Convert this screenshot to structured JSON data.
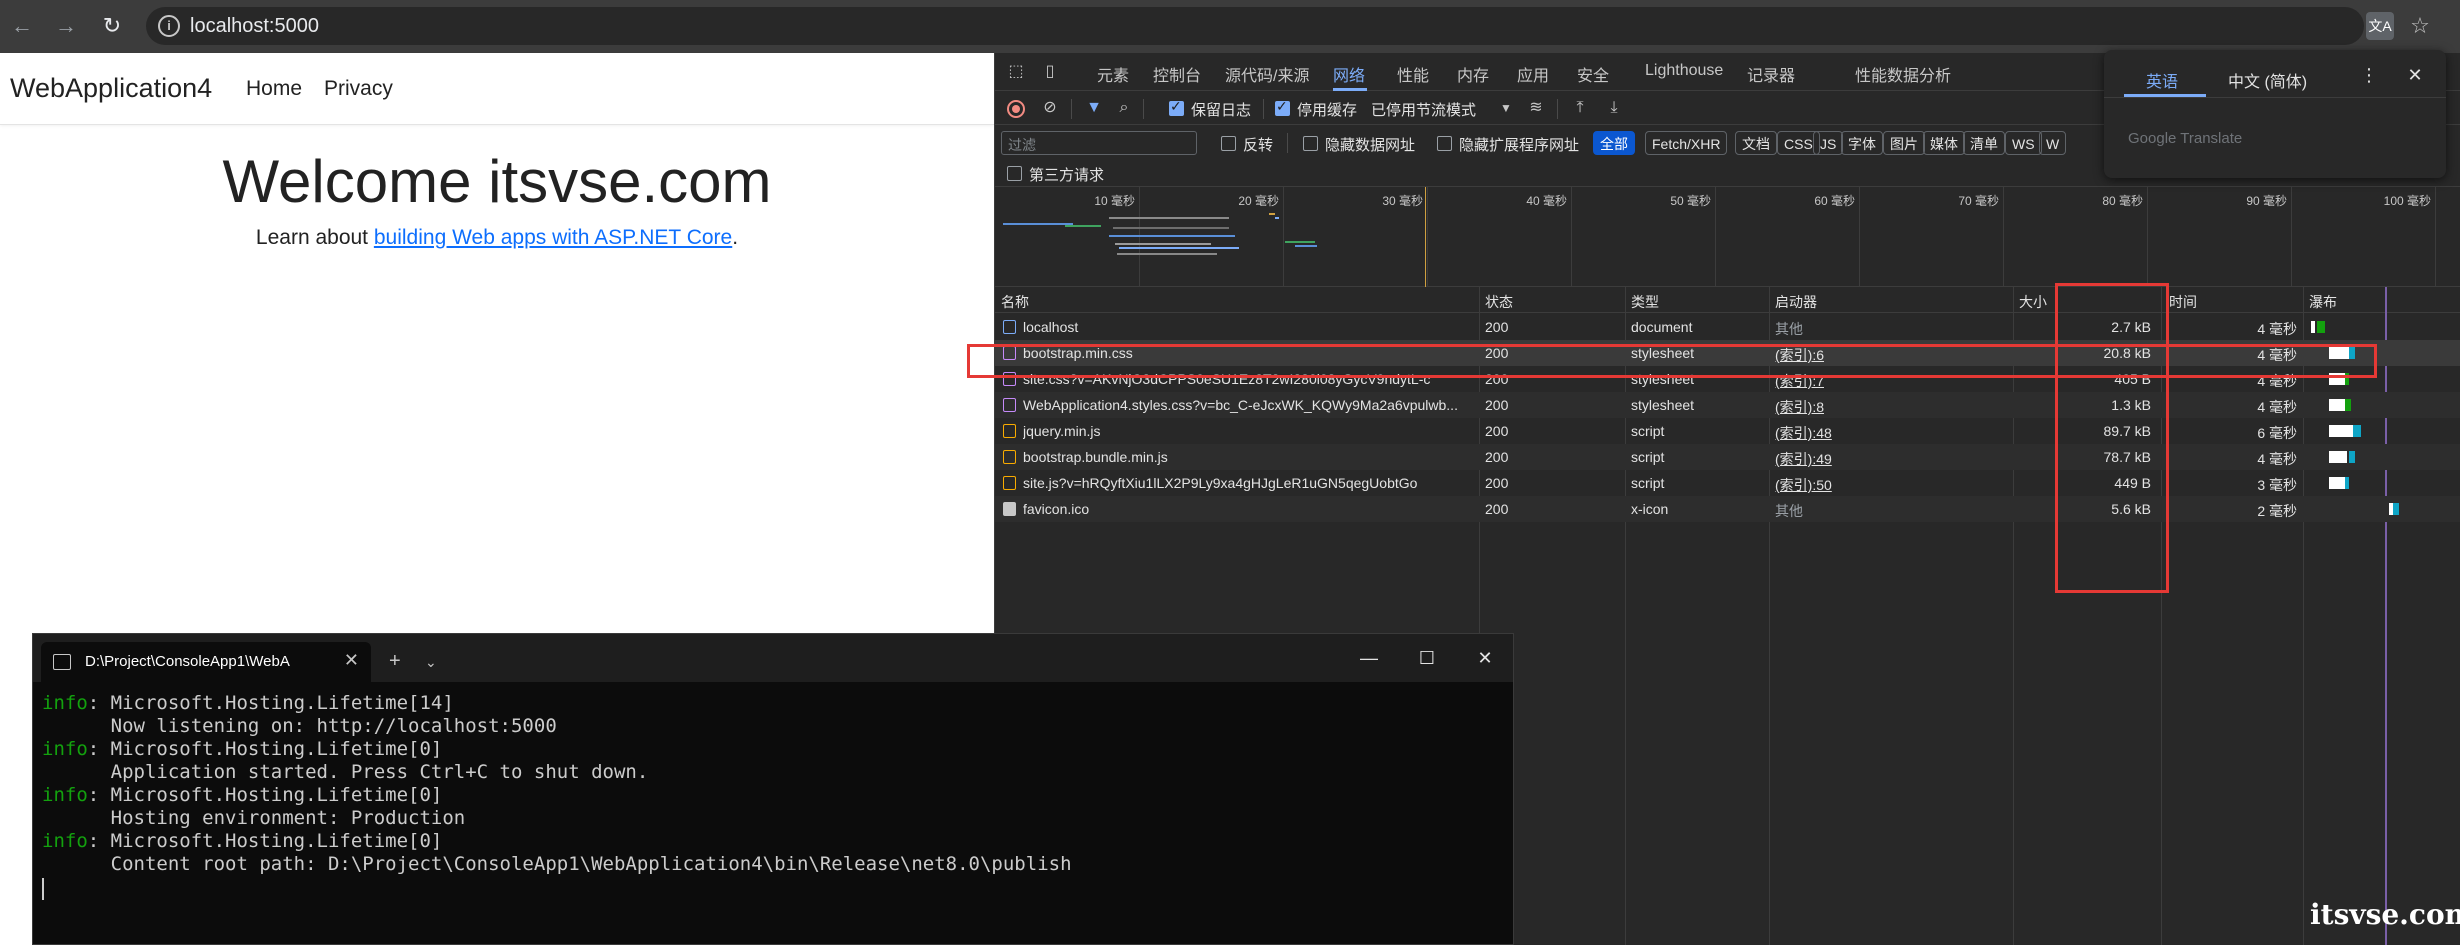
{
  "browser": {
    "url": "localhost:5000"
  },
  "webpage": {
    "brand": "WebApplication4",
    "nav": [
      "Home",
      "Privacy"
    ],
    "heading": "Welcome itsvse.com",
    "learn_prefix": "Learn about ",
    "learn_link": "building Web apps with ASP.NET Core",
    "learn_suffix": "."
  },
  "devtools": {
    "tabs": [
      "元素",
      "控制台",
      "源代码/来源",
      "网络",
      "性能",
      "内存",
      "应用",
      "安全",
      "Lighthouse",
      "记录器",
      "性能数据分析"
    ],
    "selected_tab": "网络",
    "toolbar": {
      "preserve_log": "保留日志",
      "disable_cache": "停用缓存",
      "throttling": "已停用节流模式"
    },
    "filter": {
      "placeholder": "过滤",
      "invert": "反转",
      "hide_data_urls": "隐藏数据网址",
      "hide_extension_urls": "隐藏扩展程序网址",
      "chips": [
        "全部",
        "Fetch/XHR",
        "文档",
        "CSS",
        "JS",
        "字体",
        "图片",
        "媒体",
        "清单",
        "WS",
        "W"
      ],
      "active_chip": "全部",
      "third_party": "第三方请求"
    },
    "overview_ticks": [
      "10 毫秒",
      "20 毫秒",
      "30 毫秒",
      "40 毫秒",
      "50 毫秒",
      "60 毫秒",
      "70 毫秒",
      "80 毫秒",
      "90 毫秒",
      "100 毫秒"
    ],
    "columns": {
      "name": "名称",
      "status": "状态",
      "type": "类型",
      "initiator": "启动器",
      "size": "大小",
      "time": "时间",
      "waterfall": "瀑布"
    },
    "rows": [
      {
        "name": "localhost",
        "status": "200",
        "type": "document",
        "initiator": "其他",
        "size": "2.7 kB",
        "time": "4 毫秒",
        "icon": "document-icon"
      },
      {
        "name": "bootstrap.min.css",
        "status": "200",
        "type": "stylesheet",
        "initiator": "(索引):6",
        "size": "20.8 kB",
        "time": "4 毫秒",
        "icon": "stylesheet-icon"
      },
      {
        "name": "site.css?v=AKvNjO3dCPPS0eSU1Ez8T2wI280i08yGycV9ndytL-c",
        "status": "200",
        "type": "stylesheet",
        "initiator": "(索引):7",
        "size": "405 B",
        "time": "4 毫秒",
        "icon": "stylesheet-icon"
      },
      {
        "name": "WebApplication4.styles.css?v=bc_C-eJcxWK_KQWy9Ma2a6vpulwb...",
        "status": "200",
        "type": "stylesheet",
        "initiator": "(索引):8",
        "size": "1.3 kB",
        "time": "4 毫秒",
        "icon": "stylesheet-icon"
      },
      {
        "name": "jquery.min.js",
        "status": "200",
        "type": "script",
        "initiator": "(索引):48",
        "size": "89.7 kB",
        "time": "6 毫秒",
        "icon": "script-icon"
      },
      {
        "name": "bootstrap.bundle.min.js",
        "status": "200",
        "type": "script",
        "initiator": "(索引):49",
        "size": "78.7 kB",
        "time": "4 毫秒",
        "icon": "script-icon"
      },
      {
        "name": "site.js?v=hRQyftXiu1lLX2P9Ly9xa4gHJgLeR1uGN5qegUobtGo",
        "status": "200",
        "type": "script",
        "initiator": "(索引):50",
        "size": "449 B",
        "time": "3 毫秒",
        "icon": "script-icon"
      },
      {
        "name": "favicon.ico",
        "status": "200",
        "type": "x-icon",
        "initiator": "其他",
        "size": "5.6 kB",
        "time": "2 毫秒",
        "icon": "icon-file-icon"
      }
    ]
  },
  "translate_popup": {
    "tabs": [
      "英语",
      "中文 (简体)"
    ],
    "brand": "Google Translate"
  },
  "terminal": {
    "tab_title": "D:\\Project\\ConsoleApp1\\WebA",
    "lines": [
      {
        "prefix": "info",
        "text": ": Microsoft.Hosting.Lifetime[14]"
      },
      {
        "prefix": "",
        "text": "      Now listening on: http://localhost:5000"
      },
      {
        "prefix": "info",
        "text": ": Microsoft.Hosting.Lifetime[0]"
      },
      {
        "prefix": "",
        "text": "      Application started. Press Ctrl+C to shut down."
      },
      {
        "prefix": "info",
        "text": ": Microsoft.Hosting.Lifetime[0]"
      },
      {
        "prefix": "",
        "text": "      Hosting environment: Production"
      },
      {
        "prefix": "info",
        "text": ": Microsoft.Hosting.Lifetime[0]"
      },
      {
        "prefix": "",
        "text": "      Content root path: D:\\Project\\ConsoleApp1\\WebApplication4\\bin\\Release\\net8.0\\publish"
      }
    ]
  },
  "watermark": "itsvse.com",
  "colors": {
    "highlight": "#e53935",
    "accent": "#7cacf8",
    "link": "#0d6efd",
    "info_green": "#13a10e"
  }
}
